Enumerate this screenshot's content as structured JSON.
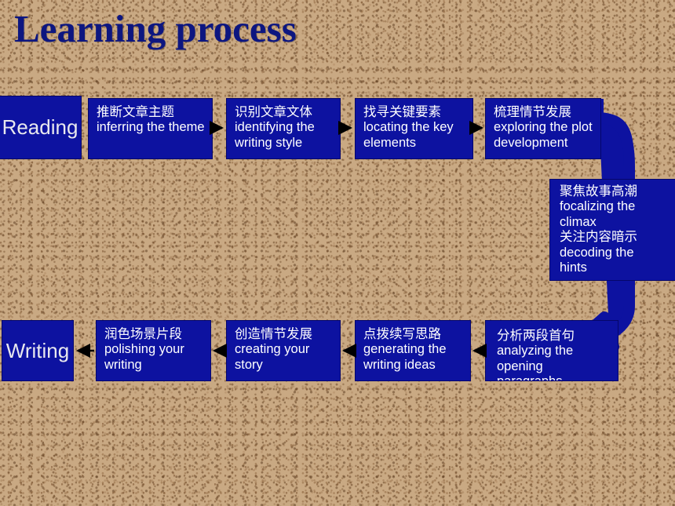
{
  "slide": {
    "title": "Learning process",
    "background_color": "#c8a882",
    "box_color": "#0d12a0",
    "title_color": "#0d1680",
    "arrow_color": "#000000",
    "curve_color": "#0d12a0"
  },
  "stages": {
    "reading": "Reading",
    "writing": "Writing"
  },
  "reading_steps": [
    {
      "cn": "推断文章主题",
      "en": "inferring the theme"
    },
    {
      "cn": "识别文章文体",
      "en": "identifying the\nwriting style"
    },
    {
      "cn": "找寻关键要素",
      "en": "locating the key\nelements"
    },
    {
      "cn": "梳理情节发展",
      "en": "exploring the plot\ndevelopment"
    }
  ],
  "bridge": {
    "cn1": "聚焦故事高潮",
    "en1": "focalizing the\nclimax",
    "cn2": "关注内容暗示",
    "en2": "decoding the\nhints"
  },
  "writing_steps": [
    {
      "cn": "润色场景片段",
      "en": "polishing your\nwriting"
    },
    {
      "cn": "创造情节发展",
      "en": "creating your\nstory"
    },
    {
      "cn": "点拨续写思路",
      "en": "generating the\nwriting ideas"
    },
    {
      "cn": "分析两段首句",
      "en": "analyzing the opening\nparagraphs"
    }
  ]
}
